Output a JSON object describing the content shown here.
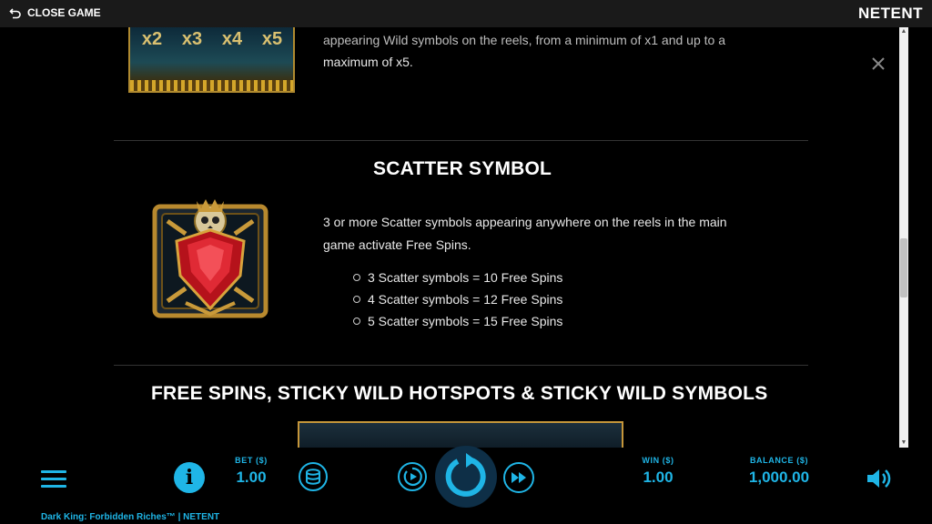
{
  "topbar": {
    "close_label": "CLOSE GAME",
    "brand": "NETENT"
  },
  "wild_multiplier": {
    "multipliers": [
      "x2",
      "x3",
      "x4",
      "x5"
    ],
    "line1": "appearing Wild symbols on the reels, from a minimum of x1 and up to a",
    "line2": "maximum of x5."
  },
  "scatter": {
    "title": "SCATTER SYMBOL",
    "line1": "3 or more Scatter symbols appearing anywhere on the reels in the main",
    "line2": "game activate Free Spins.",
    "bullets": [
      "3 Scatter symbols = 10 Free Spins",
      "4 Scatter symbols = 12 Free Spins",
      "5 Scatter symbols = 15 Free Spins"
    ]
  },
  "free_spins": {
    "title": "FREE SPINS, STICKY WILD HOTSPOTS & STICKY WILD SYMBOLS"
  },
  "bottombar": {
    "bet_label": "BET ($)",
    "bet_value": "1.00",
    "win_label": "WIN ($)",
    "win_value": "1.00",
    "balance_label": "BALANCE ($)",
    "balance_value": "1,000.00",
    "game_title": "Dark King: Forbidden Riches™  |  NETENT"
  },
  "colors": {
    "accent": "#1fb5e6",
    "background": "#000000",
    "topbar": "#1a1a1a",
    "spin_button": "#0e2f47"
  },
  "icons": [
    "back-arrow-icon",
    "close-icon",
    "menu-icon",
    "info-icon",
    "coins-icon",
    "autoplay-icon",
    "spin-icon",
    "turbo-icon",
    "sound-icon"
  ]
}
